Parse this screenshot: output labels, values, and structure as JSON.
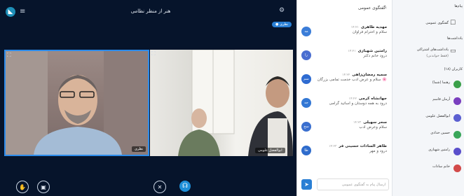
{
  "header": {
    "room_title": "هنر از منظر نظامی",
    "presenter_badge": "● نظری"
  },
  "videos": {
    "left_label": "نظری",
    "right_label": "ابوالفضل علومی"
  },
  "chat": {
    "title": "گفتگوی عمومی",
    "messages": [
      {
        "name": "مهدیه طاهری",
        "time": "۱۴:۲۱",
        "text": "سلام و احترام فراوان",
        "avatar_text": "مه",
        "color": "#3b7dd8"
      },
      {
        "name": "رامتین شهبازی",
        "time": "۱۴:۲۱",
        "text": "درود خانم دکتر",
        "avatar_text": "را",
        "color": "#4a6ed0"
      },
      {
        "name": "سمیه رمضان‌زاهی",
        "time": "۱۴:۲۲",
        "text": "سلام و عرض ادب خدمت تمامی بزرگان 🌸",
        "avatar_text": "سم",
        "color": "#2e6bd1"
      },
      {
        "name": "جهانشاه کرمی",
        "time": "۱۴:۲۲",
        "text": "درود به همه دوستان و اساتید گرامی",
        "avatar_text": "جه",
        "color": "#3377d4"
      },
      {
        "name": "سحر سهیلی",
        "time": "۱۴:۲۳",
        "text": "سلام وعرض ادب",
        "avatar_text": "سح",
        "color": "#3a6fcf"
      },
      {
        "name": "طاهر السادات حسینی فر",
        "time": "۱۴:۲۳",
        "text": "درود و مهر",
        "avatar_text": "طا",
        "color": "#2f6ccc"
      }
    ],
    "input_placeholder": "ارسال پیام به گفتگوی عمومی"
  },
  "sidebar": {
    "heading_messages": "پیام‌ها",
    "public_chat": "گفتگوی عمومی",
    "heading_notes": "یادداشت‌ها",
    "shared_notes": "یادداشت‌های اشتراکی",
    "shared_notes_sub": "(فقط خواندنی)",
    "users_heading": "کاربران (۱۸)",
    "users": [
      {
        "name": "رهنما",
        "sub": "(شما)",
        "color": "#3ba04a"
      },
      {
        "name": "آرمان قاسم",
        "sub": "",
        "color": "#7a3fbf"
      },
      {
        "name": "ابوالفضل علومی",
        "sub": "",
        "color": "#5b5fd1"
      },
      {
        "name": "حسین خدادی",
        "sub": "",
        "color": "#3aa65a"
      },
      {
        "name": "رامتین شهبازی",
        "sub": "",
        "color": "#5a4fcb"
      },
      {
        "name": "خانم سادات",
        "sub": "",
        "color": "#d24a4a"
      }
    ]
  }
}
